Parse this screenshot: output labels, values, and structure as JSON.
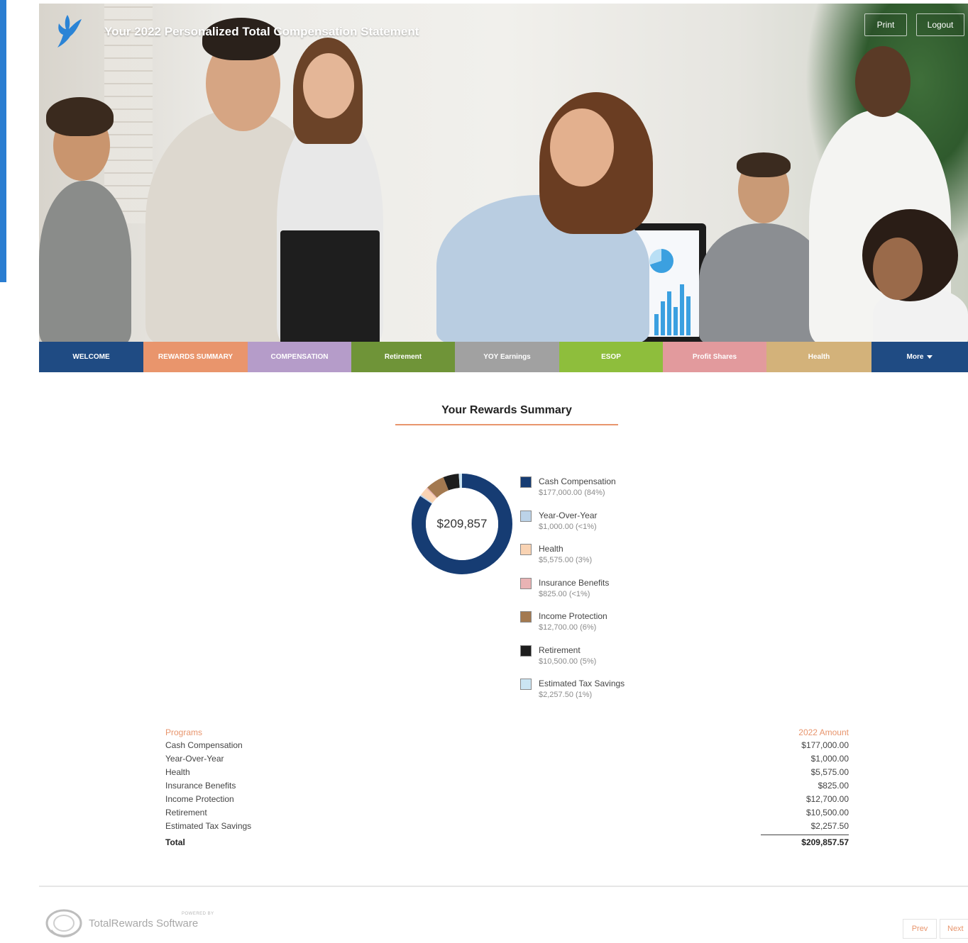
{
  "header": {
    "title": "Your 2022 Personalized Total Compensation Statement",
    "print_label": "Print",
    "logout_label": "Logout"
  },
  "nav": [
    {
      "label": "WELCOME",
      "color": "#1f4b83",
      "width": 147
    },
    {
      "label": "REWARDS SUMMARY",
      "color": "#e9956c",
      "width": 147
    },
    {
      "label": "COMPENSATION",
      "color": "#b59cc9",
      "width": 146
    },
    {
      "label": "Retirement",
      "color": "#6f9438",
      "width": 146
    },
    {
      "label": "YOY Earnings",
      "color": "#a1a1a1",
      "width": 147
    },
    {
      "label": "ESOP",
      "color": "#8ebe3c",
      "width": 146
    },
    {
      "label": "Profit Shares",
      "color": "#e29a9d",
      "width": 146
    },
    {
      "label": "Health",
      "color": "#d3b27a",
      "width": 148
    },
    {
      "label": "More",
      "color": "#1f4b83",
      "width": 136
    }
  ],
  "summary": {
    "title": "Your Rewards Summary",
    "total_display": "$209,857"
  },
  "chart_data": {
    "type": "pie",
    "title": "Your Rewards Summary",
    "center_label": "$209,857",
    "categories": [
      "Cash Compensation",
      "Year-Over-Year",
      "Health",
      "Insurance Benefits",
      "Income Protection",
      "Retirement",
      "Estimated Tax Savings"
    ],
    "values": [
      177000,
      1000,
      5575,
      825,
      12700,
      10500,
      2257.5
    ],
    "labels": [
      "$177,000.00 (84%)",
      "$1,000.00 (<1%)",
      "$5,575.00 (3%)",
      "$825.00 (<1%)",
      "$12,700.00 (6%)",
      "$10,500.00 (5%)",
      "$2,257.50 (1%)"
    ],
    "colors": [
      "#163c73",
      "#bcd3e8",
      "#f9d3b3",
      "#e9b3b4",
      "#a37950",
      "#1d1d1d",
      "#cbe5f3"
    ],
    "legend_position": "right"
  },
  "table": {
    "col_program": "Programs",
    "col_amount": "2022 Amount",
    "rows": [
      {
        "program": "Cash Compensation",
        "amount": "$177,000.00"
      },
      {
        "program": "Year-Over-Year",
        "amount": "$1,000.00"
      },
      {
        "program": "Health",
        "amount": "$5,575.00"
      },
      {
        "program": "Insurance Benefits",
        "amount": "$825.00"
      },
      {
        "program": "Income Protection",
        "amount": "$12,700.00"
      },
      {
        "program": "Retirement",
        "amount": "$10,500.00"
      },
      {
        "program": "Estimated Tax Savings",
        "amount": "$2,257.50"
      }
    ],
    "total_label": "Total",
    "total_amount": "$209,857.57"
  },
  "footer": {
    "powered_by": "POWERED BY",
    "brand": "TotalRewards Software",
    "prev_label": "Prev",
    "next_label": "Next"
  }
}
